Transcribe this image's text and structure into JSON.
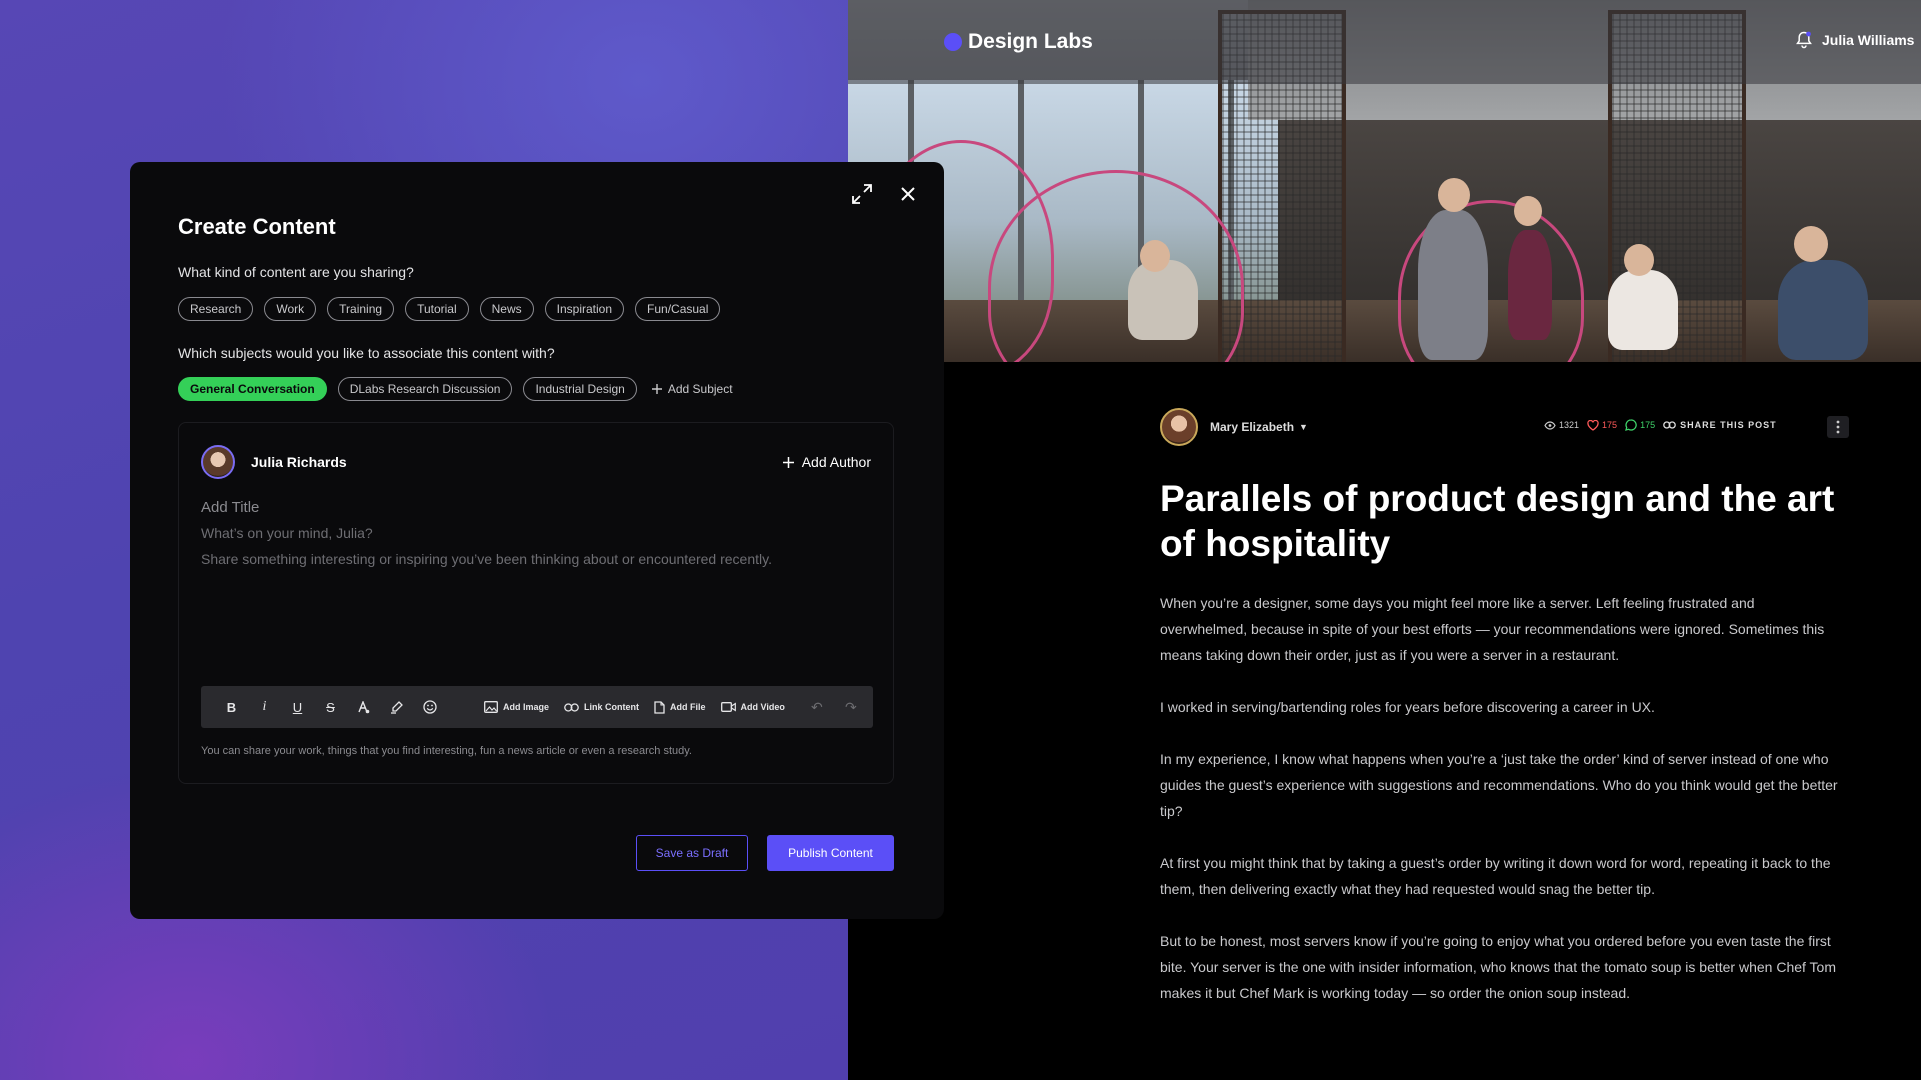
{
  "header": {
    "brand": "Design Labs",
    "user_name": "Julia Williams",
    "brand_color": "#5b4ff7"
  },
  "article": {
    "author": "Mary Elizabeth",
    "views": "1321",
    "likes": "175",
    "comments": "175",
    "share_label": "SHARE THIS POST",
    "title": "Parallels of product design and the art of hospitality",
    "paragraphs": [
      "When you’re a designer, some days you might feel more like a server. Left feeling frustrated and overwhelmed, because in spite of your best efforts — your recommendations were ignored. Sometimes this means taking down their order, just as if you were a server in a restaurant.",
      "I worked in serving/bartending roles for years before discovering a career in UX.",
      "In my experience, I know what happens when you’re a ‘just take the order’ kind of server instead of one who guides the guest’s experience with suggestions and recommendations. Who do you think would get the better tip?",
      "At first you might think that by taking a guest’s order by writing it down word for word, repeating it back to the them, then delivering exactly what they had requested would snag the better tip.",
      "But to be honest, most servers know if you’re going to enjoy what you ordered before you even taste the first bite. Your server is the one with insider information, who knows that the tomato soup is better when Chef Tom makes it but Chef Mark is working today — so order the onion soup instead."
    ]
  },
  "modal": {
    "title": "Create Content",
    "content_question": "What kind of content are you sharing?",
    "content_types": [
      "Research",
      "Work",
      "Training",
      "Tutorial",
      "News",
      "Inspiration",
      "Fun/Casual"
    ],
    "subject_question": "Which subjects would you like to associate this content with?",
    "subjects": [
      "General Conversation",
      "DLabs Research Discussion",
      "Industrial Design"
    ],
    "add_subject_label": "Add Subject",
    "editor": {
      "author": "Julia Richards",
      "add_author_label": "Add Author",
      "title_placeholder": "Add Title",
      "mind_placeholder": "What’s on your mind, Julia?",
      "share_placeholder": "Share something interesting or inspiring you’ve been thinking about or encountered recently.",
      "toolbar": {
        "add_image": "Add Image",
        "link_content": "Link Content",
        "add_file": "Add File",
        "add_video": "Add Video"
      },
      "helper_text": "You can share your work, things that you find interesting, fun a news article or even a research study."
    },
    "save_draft_label": "Save as Draft",
    "publish_label": "Publish Content",
    "active_chip_color": "#34d058"
  }
}
